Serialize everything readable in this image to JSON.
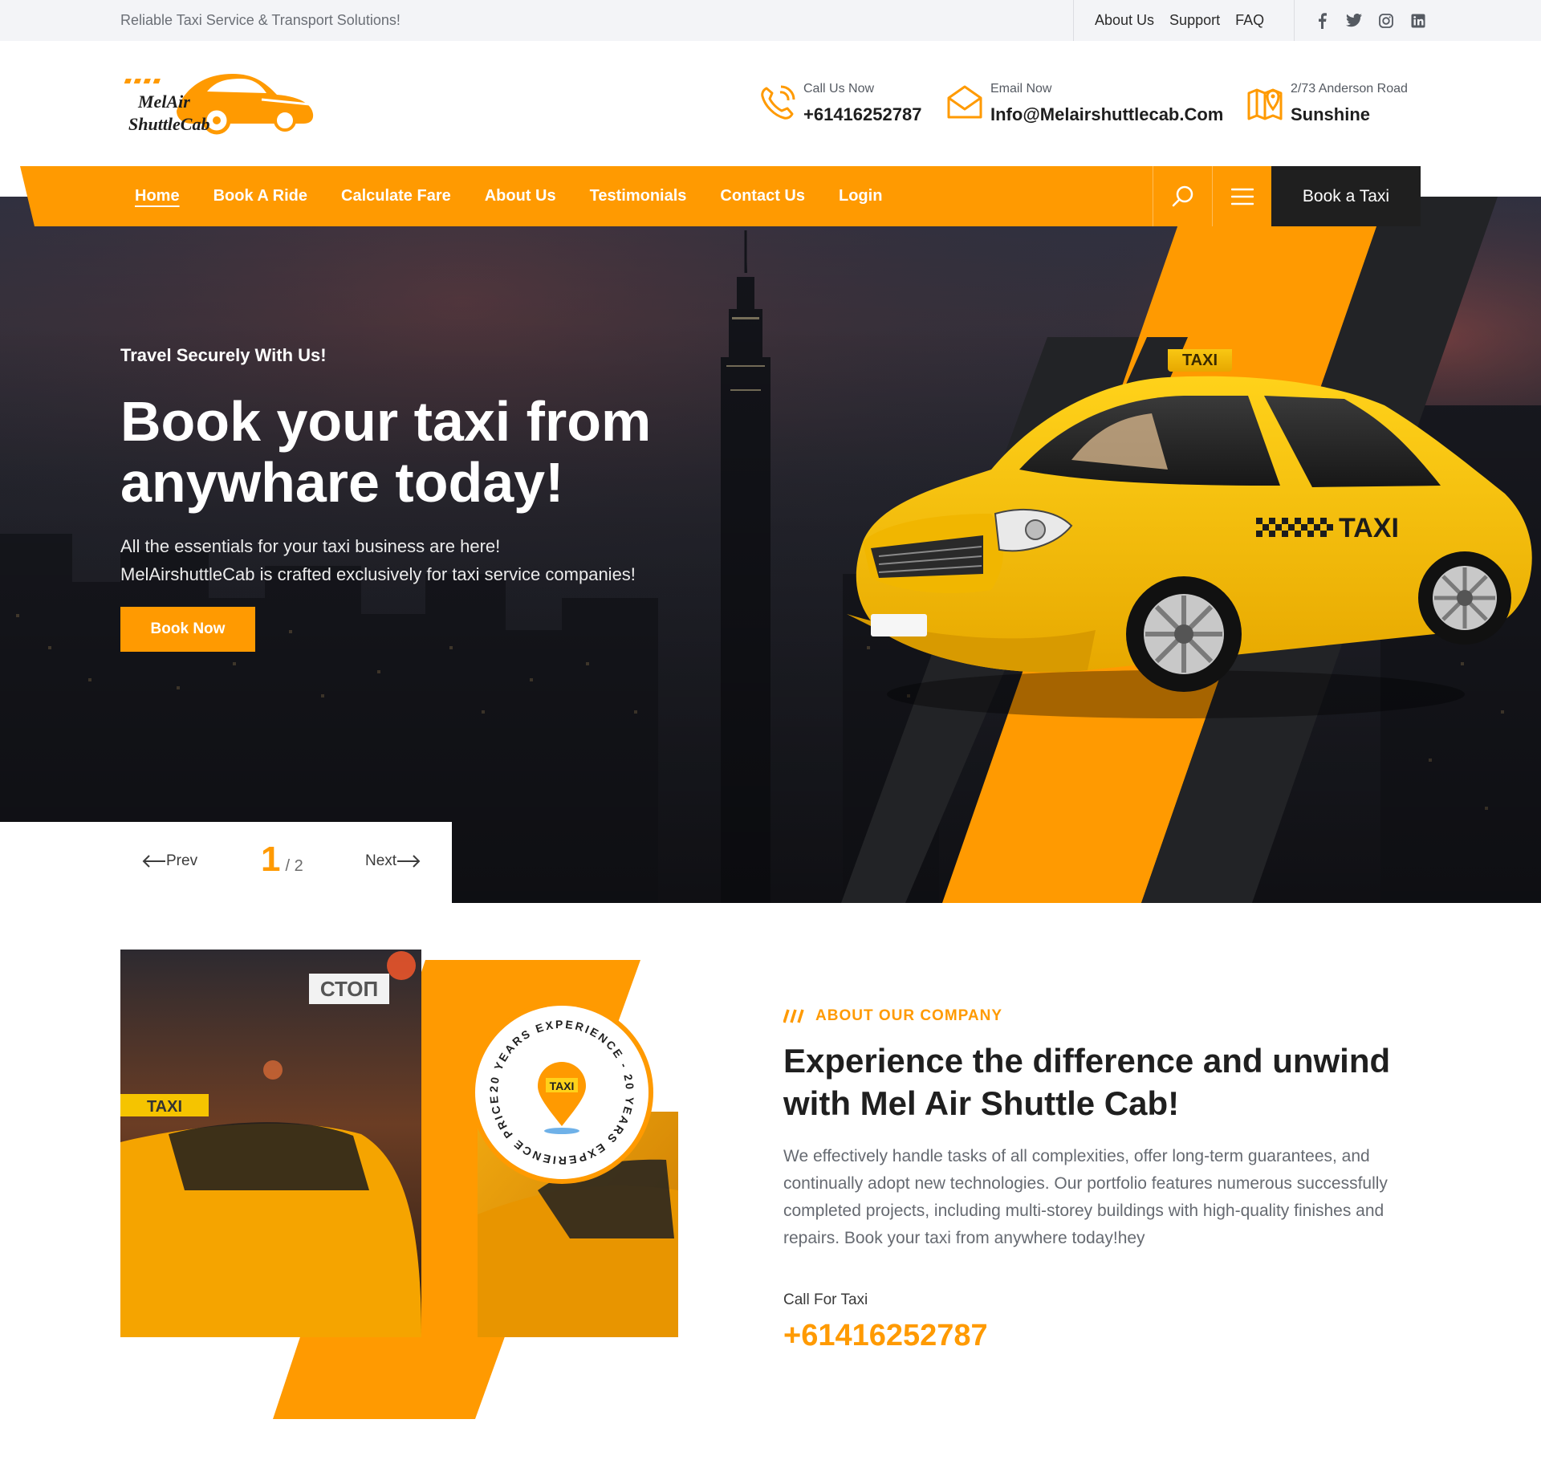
{
  "colors": {
    "accent": "#ff9a01",
    "dark": "#1f1f1f",
    "taxi_yellow": "#f5c400"
  },
  "topbar": {
    "tagline": "Reliable Taxi Service & Transport Solutions!",
    "links": [
      "About Us",
      "Support",
      "FAQ"
    ],
    "social_icons": [
      "facebook-icon",
      "twitter-icon",
      "instagram-icon",
      "linkedin-icon"
    ]
  },
  "logo": {
    "line1": "MelAir",
    "line2": "ShuttleCab"
  },
  "contacts": {
    "call": {
      "label": "Call Us Now",
      "value": "+61416252787",
      "icon": "phone-icon"
    },
    "email": {
      "label": "Email Now",
      "value": "Info@Melairshuttlecab.Com",
      "icon": "envelope-icon"
    },
    "address": {
      "label": "2/73 Anderson Road",
      "value": "Sunshine",
      "icon": "map-pin-icon"
    }
  },
  "nav": {
    "items": [
      "Home",
      "Book A Ride",
      "Calculate Fare",
      "About Us",
      "Testimonials",
      "Contact Us",
      "Login"
    ],
    "active": "Home",
    "cta": "Book a Taxi"
  },
  "hero": {
    "subtitle": "Travel Securely With Us!",
    "title": "Book your taxi from anywhare today!",
    "desc_line1": "All the essentials for your taxi business are here!",
    "desc_line2": "MelAirshuttleCab is crafted exclusively for taxi service companies!",
    "button": "Book Now",
    "car_sign": "TAXI",
    "car_side": "TAXI",
    "sign_text": "СТОП"
  },
  "slider": {
    "prev": "Prev",
    "next": "Next",
    "current": "1",
    "total": "/ 2"
  },
  "about": {
    "tag": "ABOUT OUR COMPANY",
    "title": "Experience the difference and unwind with Mel Air Shuttle Cab!",
    "desc": "We effectively handle tasks of all complexities, offer long-term guarantees, and continually adopt new technologies. Our portfolio features numerous successfully completed projects, including multi-storey buildings with high-quality finishes and repairs. Book your taxi from anywhere today!hey",
    "badge_ring_text": "20 YEARS EXPERIENCE - 20 YEARS EXPERIENCE PRICE - ",
    "badge_center": "TAXI",
    "call_label": "Call For Taxi",
    "call_phone": "+61416252787"
  }
}
